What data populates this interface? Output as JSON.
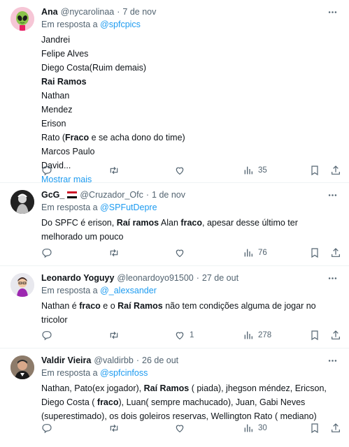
{
  "tweets": [
    {
      "name": "Ana",
      "handle": "@nycarolinaa",
      "separator": "·",
      "time": "7 de nov",
      "reply_prefix": "Em resposta a",
      "reply_to": "@spfcpics",
      "lines": [
        "Jandrei",
        "Felipe Alves",
        "Diego Costa(Ruim demais)",
        "Rai Ramos",
        "Nathan",
        "Mendez",
        "Erison",
        "Rato (Fraco e se acha dono do time)",
        "Marcos Paulo",
        "David..."
      ],
      "show_more": "Mostrar mais",
      "views": "35",
      "retweets": "",
      "likes": ""
    },
    {
      "name": "GcG_",
      "handle": "@Cruzador_Ofc",
      "separator": "·",
      "time": "1 de nov",
      "reply_prefix": "Em resposta a",
      "reply_to": "@SPFutDepre",
      "text_1a": "Do SPFC é erison, ",
      "text_1b": "Raí ramos",
      "text_1c": " Alan ",
      "text_1d": "fraco",
      "text_1e": ", apesar desse último ter",
      "text_2": "melhorado um pouco",
      "views": "76"
    },
    {
      "name": "Leonardo Yoguyy",
      "handle": "@leonardoyo91500",
      "separator": "·",
      "time": "27 de out",
      "reply_prefix": "Em resposta a",
      "reply_to": "@_alexsander",
      "text_1a": "Nathan é ",
      "text_1b": "fraco",
      "text_1c": " e o ",
      "text_1d": "Raí Ramos",
      "text_1e": " não tem condições alguma de jogar no",
      "text_2": "tricolor",
      "likes": "1",
      "views": "278"
    },
    {
      "name": "Valdir Vieira",
      "handle": "@valdirbb",
      "separator": "·",
      "time": "26 de out",
      "reply_prefix": "Em resposta a",
      "reply_to": "@spfcinfoss",
      "text_1a": "Nathan, Pato(ex jogador), ",
      "text_1b": "Raí Ramos",
      "text_1c": " ( piada), jhegson méndez, Ericson,",
      "text_2a": "Diego Costa ( ",
      "text_2b": "fraco",
      "text_2c": "), Luan( sempre machucado), Juan, Gabi Neves",
      "text_3": "(superestimado), os dois goleiros reservas, Wellington Rato ( mediano)",
      "views": "30"
    }
  ],
  "colors": {
    "link": "#1d9bf0",
    "muted": "#536471",
    "text": "#0f1419",
    "divider": "#eff3f4"
  },
  "icons": [
    "more-icon",
    "reply-icon",
    "retweet-icon",
    "like-icon",
    "views-icon",
    "bookmark-icon",
    "share-icon",
    "alien-avatar",
    "flag-icon"
  ]
}
